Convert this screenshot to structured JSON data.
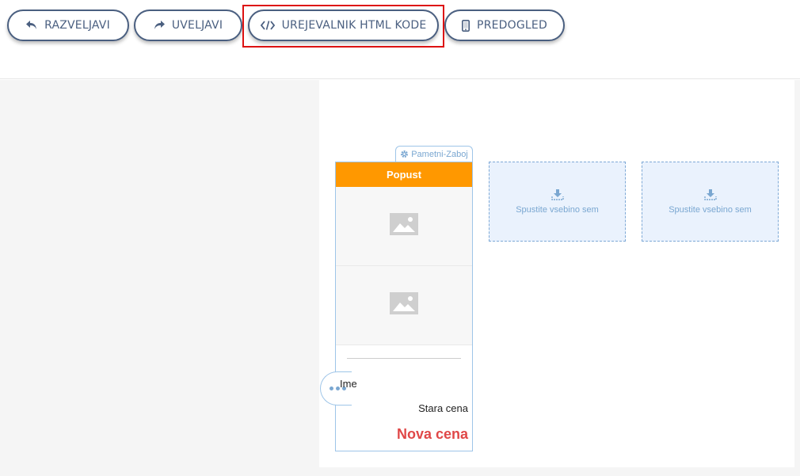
{
  "toolbar": {
    "undo_label": "RAZVELJAVI",
    "undo_icon": "undo-icon",
    "redo_label": "UVELJAVI",
    "redo_icon": "redo-icon",
    "html_label": "UREJEVALNIK HTML KODE",
    "html_icon": "code-icon",
    "preview_label": "PREDOGLED",
    "preview_icon": "mobile-icon",
    "button_color": "#4a5f80",
    "highlight_color": "#dd1111"
  },
  "smart_box": {
    "label": "Pametni-Zaboj",
    "label_icon": "gear-icon",
    "accent_color": "#9ec5e8"
  },
  "product": {
    "header": "Popust",
    "header_color": "#ff9800",
    "image_icon": "image-placeholder-icon",
    "name": "Ime",
    "old_price": "Stara cena",
    "new_price": "Nova cena",
    "new_price_color": "#e04848"
  },
  "dropzones": [
    {
      "text": "Spustite vsebino sem",
      "icon": "download-icon"
    },
    {
      "text": "Spustite vsebino sem",
      "icon": "download-icon"
    }
  ]
}
